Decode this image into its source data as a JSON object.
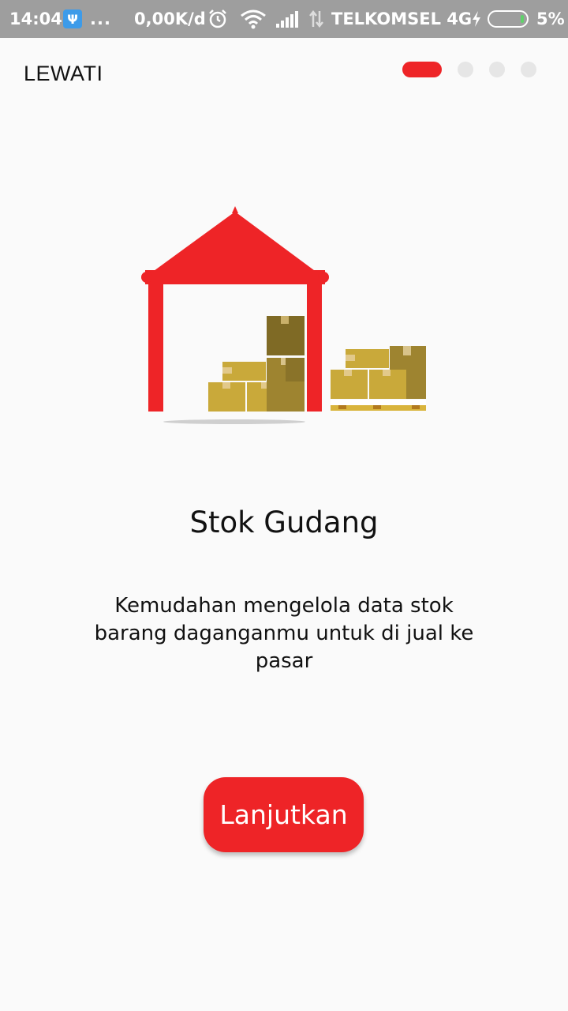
{
  "status_bar": {
    "time": "14:04",
    "dots": "...",
    "speed": "0,00K/d",
    "carrier": "TELKOMSEL 4G",
    "battery_percent": "5%",
    "battery_level": 0.05,
    "icons": [
      "usb-icon",
      "alarm-icon",
      "wifi-icon",
      "signal-icon",
      "data-arrows-icon",
      "charging-icon",
      "battery-icon"
    ]
  },
  "header": {
    "skip_label": "LEWATI",
    "pager": {
      "total": 4,
      "active_index": 0
    }
  },
  "onboarding": {
    "illustration": "warehouse-illustration",
    "title": "Stok Gudang",
    "description": "Kemudahan mengelola data stok barang daganganmu untuk di jual ke pasar",
    "button_label": "Lanjutkan"
  },
  "colors": {
    "accent": "#ee2427",
    "status_bar": "#9e9e9e",
    "background": "#fafafa",
    "box_light": "#c9a93a",
    "box_dark": "#9e8430"
  }
}
